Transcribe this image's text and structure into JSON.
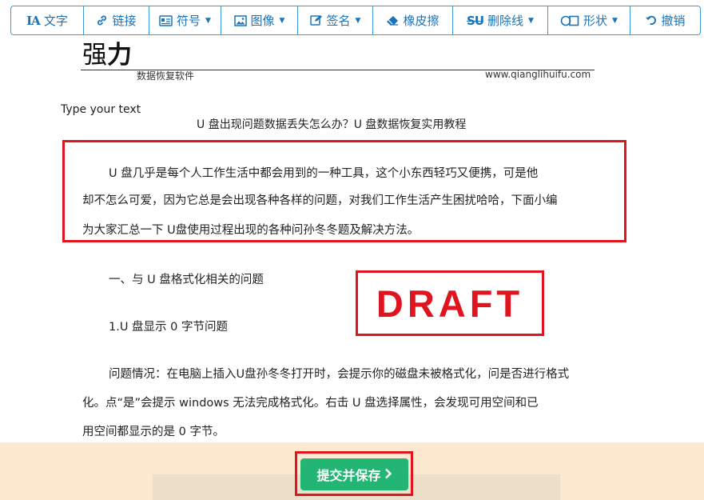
{
  "toolbar": {
    "items": [
      {
        "icon": "text-icon",
        "label": "文字",
        "dropdown": false
      },
      {
        "icon": "link-icon",
        "label": "链接",
        "dropdown": false
      },
      {
        "icon": "symbol-card-icon",
        "label": "符号",
        "dropdown": true
      },
      {
        "icon": "image-icon",
        "label": "图像",
        "dropdown": true
      },
      {
        "icon": "signature-edit-icon",
        "label": "签名",
        "dropdown": true
      },
      {
        "icon": "eraser-icon",
        "label": "橡皮擦",
        "dropdown": false
      },
      {
        "icon": "strikethrough-icon",
        "label": "删除线",
        "dropdown": true
      },
      {
        "icon": "shape-icon",
        "label": "形状",
        "dropdown": true
      },
      {
        "icon": "undo-icon",
        "label": "撤销",
        "dropdown": false
      }
    ],
    "text_glyph": "IA",
    "strike_glyph": "SU"
  },
  "document": {
    "logo_light": "强",
    "logo_bold": "力",
    "subtitle": "数据恢复软件",
    "site_url": "www.qianglihuifu.com",
    "type_hint": "Type your text",
    "title": "U 盘出现问题数据丢失怎么办？U 盘数据恢复实用教程",
    "intro_lines": [
      "U 盘几乎是每个人工作生活中都会用到的一种工具，这个小东西轻巧又便携，可是他",
      "却不怎么可爱，因为它总是会出现各种各样的问题，对我们工作生活产生困扰哈哈，下面小编",
      "为大家汇总一下 U盘使用过程出现的各种问孙冬冬题及解决方法。"
    ],
    "section_heading": "一、与 U 盘格式化相关的问题",
    "subsection_heading": "1.U 盘显示 0 字节问题",
    "body_lines": [
      "问题情况：在电脑上插入U盘孙冬冬打开时，会提示你的磁盘未被格式化，问是否进行格式",
      "化。点“是”会提示 windows 无法完成格式化。右击 U 盘选择属性，会发现可用空间和已",
      "用空间都显示的是 0 字节。"
    ],
    "stamp": "DRAFT"
  },
  "footer": {
    "submit_label": "提交并保存"
  },
  "colors": {
    "toolbar_accent": "#1a73b8",
    "highlight_red": "#e0141e",
    "submit_green": "#22b573",
    "footer_bg": "#fde9cf"
  }
}
